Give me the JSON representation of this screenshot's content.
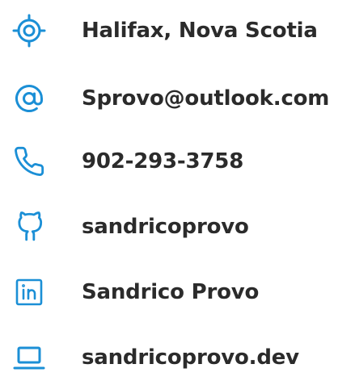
{
  "accent_color": "#1b8fd6",
  "text_color": "#2b2b2b",
  "contacts": [
    {
      "icon": "location-target-icon",
      "label": "Halifax, Nova Scotia"
    },
    {
      "icon": "at-sign-icon",
      "label": "Sprovo@outlook.com"
    },
    {
      "icon": "phone-icon",
      "label": "902-293-3758"
    },
    {
      "icon": "github-icon",
      "label": "sandricoprovo"
    },
    {
      "icon": "linkedin-icon",
      "label": "Sandrico Provo"
    },
    {
      "icon": "laptop-icon",
      "label": "sandricoprovo.dev"
    }
  ]
}
